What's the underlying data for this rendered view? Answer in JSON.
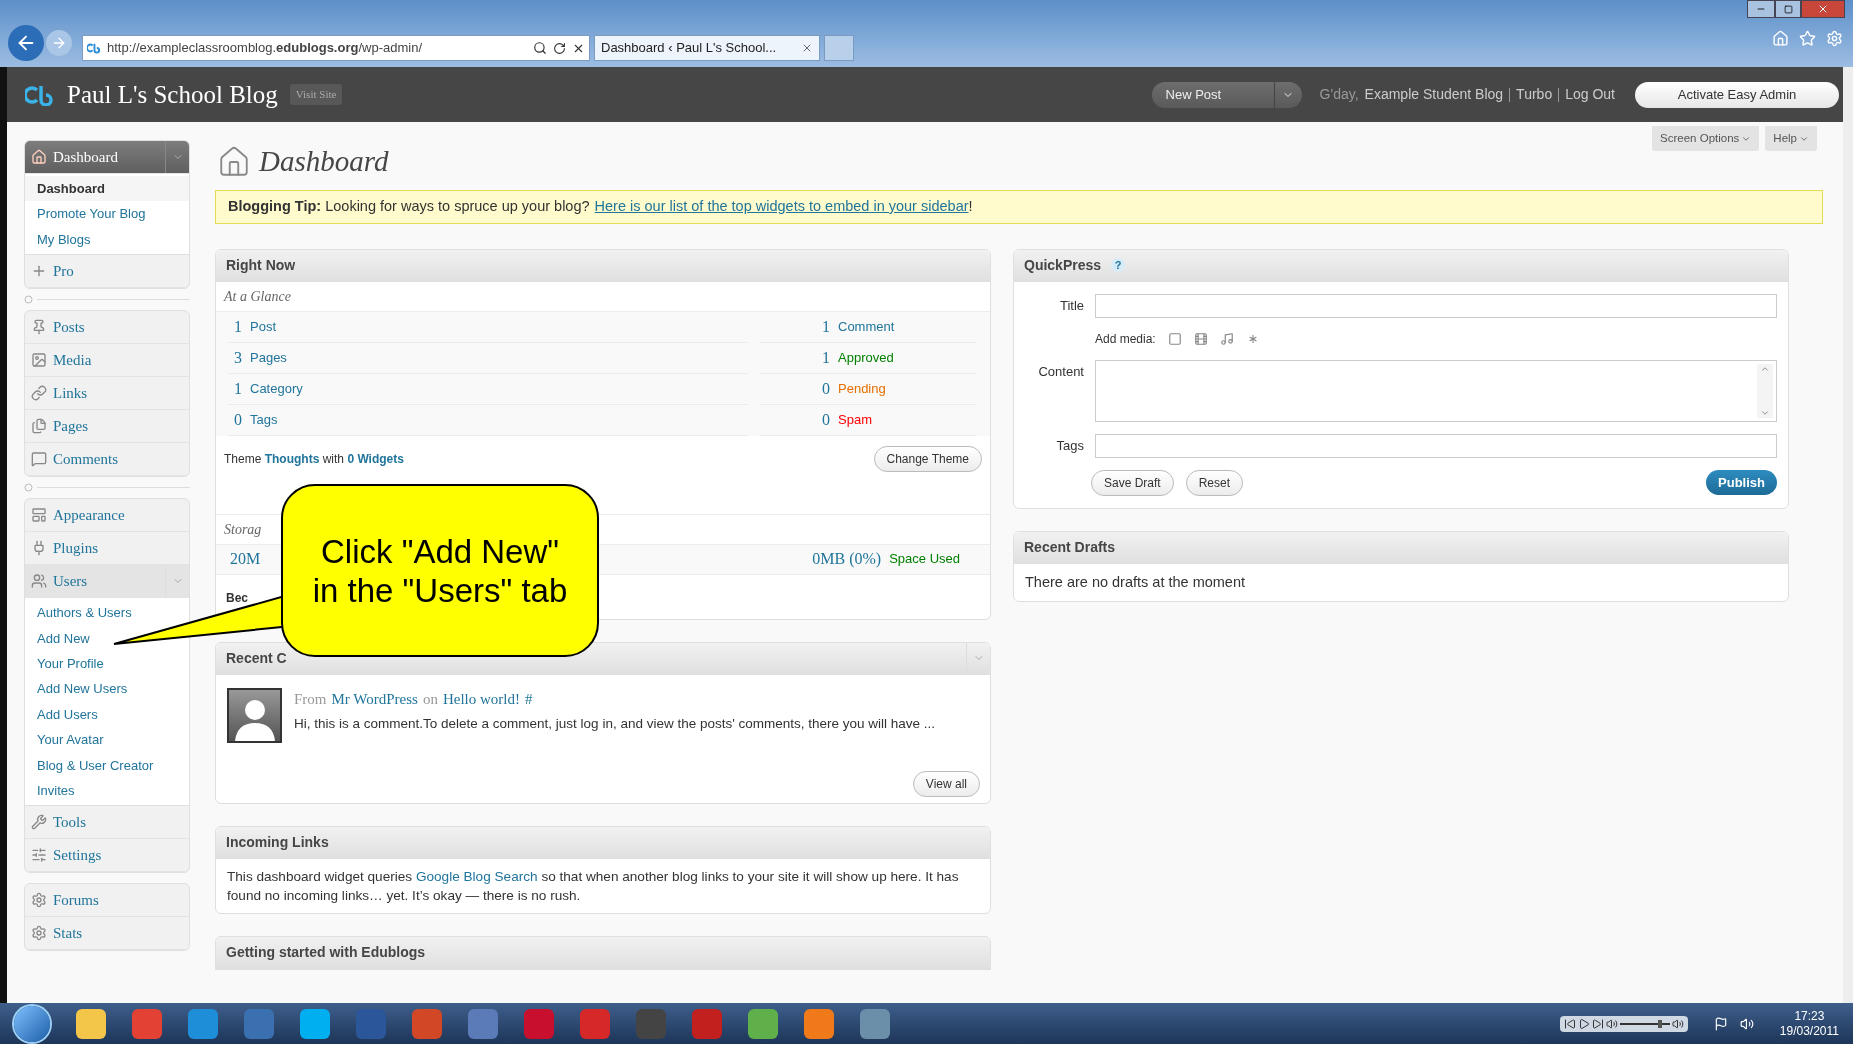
{
  "browser": {
    "url": "http://exampleclassroomblog.**edublogs.org**/wp-admin/",
    "tab": "Dashboard ‹ Paul L's School..."
  },
  "header": {
    "site_title": "Paul L's School Blog",
    "visit_site": "Visit Site",
    "new_post": "New Post",
    "greeting": "G'day,",
    "user": "Example Student Blog",
    "links": [
      "Turbo",
      "Log Out"
    ],
    "activate": "Activate Easy Admin"
  },
  "sidebar": {
    "groups": [
      {
        "items": [
          {
            "label": "Dashboard",
            "selected": true,
            "expanded": true,
            "children": [
              {
                "label": "Dashboard",
                "selected": true
              },
              {
                "label": "Promote Your Blog",
                "selected": false
              },
              {
                "label": "My Blogs",
                "selected": false
              }
            ]
          },
          {
            "label": "Pro",
            "selected": false,
            "expanded": false
          }
        ]
      },
      {
        "items": [
          {
            "label": "Posts",
            "selected": false,
            "expanded": false
          },
          {
            "label": "Media",
            "selected": false,
            "expanded": false
          },
          {
            "label": "Links",
            "selected": false,
            "expanded": false
          },
          {
            "label": "Pages",
            "selected": false,
            "expanded": false
          },
          {
            "label": "Comments",
            "selected": false,
            "expanded": false
          }
        ]
      },
      {
        "items": [
          {
            "label": "Appearance",
            "selected": false,
            "expanded": false
          },
          {
            "label": "Plugins",
            "selected": false,
            "expanded": false
          },
          {
            "label": "Users",
            "selected": false,
            "expanded": true,
            "children": [
              {
                "label": "Authors & Users",
                "selected": false
              },
              {
                "label": "Add New",
                "selected": false
              },
              {
                "label": "Your Profile",
                "selected": false
              },
              {
                "label": "Add New Users",
                "selected": false
              },
              {
                "label": "Add Users",
                "selected": false
              },
              {
                "label": "Your Avatar",
                "selected": false
              },
              {
                "label": "Blog & User Creator",
                "selected": false
              },
              {
                "label": "Invites",
                "selected": false
              }
            ]
          },
          {
            "label": "Tools",
            "selected": false,
            "expanded": false
          },
          {
            "label": "Settings",
            "selected": false,
            "expanded": false
          }
        ]
      },
      {
        "items": [
          {
            "label": "Forums",
            "selected": false,
            "expanded": false
          },
          {
            "label": "Stats",
            "selected": false,
            "expanded": false
          }
        ]
      }
    ]
  },
  "page": {
    "title": "Dashboard",
    "screen_options": "Screen Options",
    "help": "Help"
  },
  "tip": {
    "text": "**Blogging Tip:** Looking for ways to spruce up your blog?",
    "link": "Here is our list of the top widgets to embed in your sidebar",
    "end": "!"
  },
  "right_now": {
    "title": "Right Now",
    "subtitle": "At a Glance",
    "content": [
      {
        "count": "1",
        "label": "Post"
      },
      {
        "count": "3",
        "label": "Pages"
      },
      {
        "count": "1",
        "label": "Category"
      },
      {
        "count": "0",
        "label": "Tags"
      }
    ],
    "discussion": [
      {
        "count": "1",
        "label": "Comment",
        "color": "#21759b"
      },
      {
        "count": "1",
        "label": "Approved",
        "color": "#008000"
      },
      {
        "count": "0",
        "label": "Pending",
        "color": "#e66f00"
      },
      {
        "count": "0",
        "label": "Spam",
        "color": "#ff0000"
      }
    ],
    "theme": {
      "before": "Theme",
      "name": "Thoughts",
      "middle": "with",
      "widgets": "0 Widgets"
    },
    "change_theme": "Change Theme",
    "storage": {
      "title": "Storag",
      "quota": "20M",
      "used": "0MB (0%)",
      "used_label": "Space Used"
    },
    "footer": "Bec"
  },
  "recent_comments": {
    "title": "Recent C",
    "from": "From",
    "author": "Mr WordPress",
    "on": "on",
    "post": "Hello world!",
    "hash": "#",
    "excerpt": "Hi, this is a comment.To delete a comment, just log in, and view the posts' comments, there you will have ...",
    "view_all": "View all"
  },
  "incoming_links": {
    "title": "Incoming Links",
    "before": "This dashboard widget queries",
    "link": "Google Blog Search",
    "after": "so that when another blog links to your site it will show up here. It has found no incoming links… yet. It’s okay — there is no rush."
  },
  "getting_started": {
    "title": "Getting started with Edublogs"
  },
  "quickpress": {
    "title": "QuickPress",
    "help": "?",
    "title_label": "Title",
    "add_media": "Add media:",
    "content_label": "Content",
    "tags_label": "Tags",
    "save_draft": "Save Draft",
    "reset": "Reset",
    "publish": "Publish"
  },
  "recent_drafts": {
    "title": "Recent Drafts",
    "text": "There are no drafts at the moment"
  },
  "callout": {
    "lines": [
      "Click \"Add New\"",
      "in the \"Users\" tab"
    ]
  },
  "taskbar": {
    "volume": {
      "level": 0.8
    },
    "time": "17:23",
    "date": "19/03/2011"
  }
}
